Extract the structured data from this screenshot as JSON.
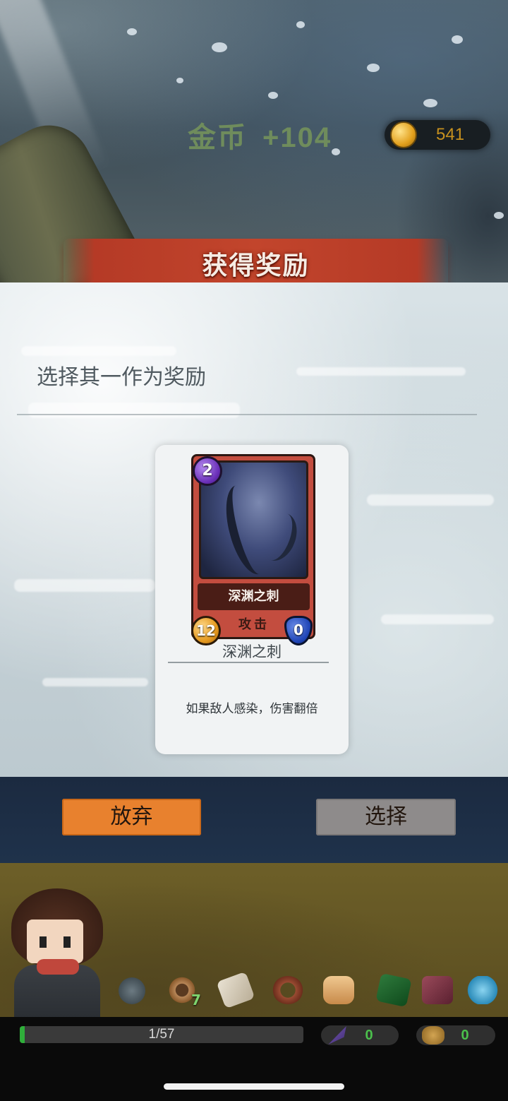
{
  "header": {
    "gold_label": "金币",
    "gold_gain": "+104",
    "coin_total": "541"
  },
  "banner": {
    "title": "获得奖励"
  },
  "panel": {
    "hint": "选择其一作为奖励"
  },
  "card": {
    "cost": "2",
    "name": "深渊之刺",
    "type": "攻击",
    "attack": "12",
    "defense": "0",
    "caption": "深渊之刺",
    "description": "如果敌人感染，伤害翻倍"
  },
  "actions": {
    "give_up": "放弃",
    "select": "选择"
  },
  "inventory": {
    "items": [
      {
        "icon": "relic-orb-icon"
      },
      {
        "icon": "rope-coil-icon",
        "count": "7"
      },
      {
        "icon": "scroll-icon"
      },
      {
        "icon": "belt-icon"
      },
      {
        "icon": "bread-icon"
      },
      {
        "icon": "green-crystal-icon"
      },
      {
        "icon": "spellbook-icon"
      },
      {
        "icon": "blue-splash-icon"
      }
    ]
  },
  "status": {
    "progress_text": "1/57",
    "progress_fraction": 0.0175,
    "stat_1_value": "0",
    "stat_2_value": "0"
  },
  "colors": {
    "banner": "#c2452c",
    "give_up_button": "#e8812e",
    "select_button": "#8e8b8b",
    "card_frame": "#c34d3f",
    "progress_fill": "#2fae3a",
    "stat_value": "#4bc04c",
    "coin_text": "#c6901e",
    "gold_label": "#6f8c5c"
  }
}
